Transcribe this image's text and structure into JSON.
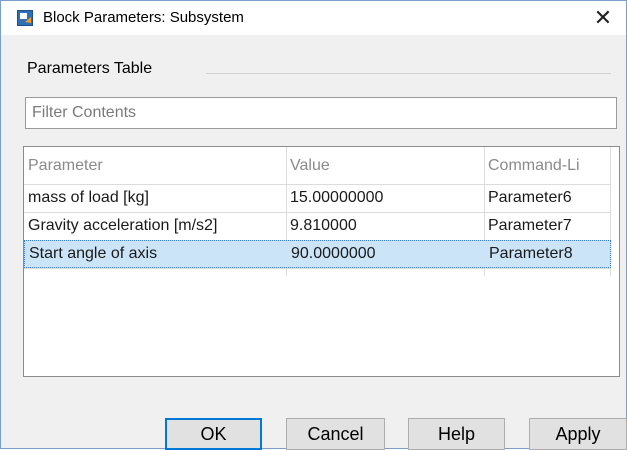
{
  "window": {
    "title": "Block Parameters: Subsystem",
    "close_glyph": "✕",
    "icon": "simulink-block-icon"
  },
  "group": {
    "title": "Parameters Table"
  },
  "filter": {
    "placeholder": "Filter Contents",
    "value": ""
  },
  "table": {
    "columns": [
      "Parameter",
      "Value",
      "Command-Li"
    ],
    "rows": [
      {
        "parameter": "mass of load [kg]",
        "value": "15.00000000",
        "command": "Parameter6",
        "selected": false
      },
      {
        "parameter": "Gravity acceleration [m/s2]",
        "value": "9.810000",
        "command": "Parameter7",
        "selected": false
      },
      {
        "parameter": "Start angle of axis",
        "value": "90.0000000",
        "command": "Parameter8",
        "selected": true
      }
    ]
  },
  "buttons": {
    "ok": "OK",
    "cancel": "Cancel",
    "help": "Help",
    "apply": "Apply"
  },
  "colors": {
    "selection": "#cce4f7",
    "accent": "#0078d7"
  }
}
